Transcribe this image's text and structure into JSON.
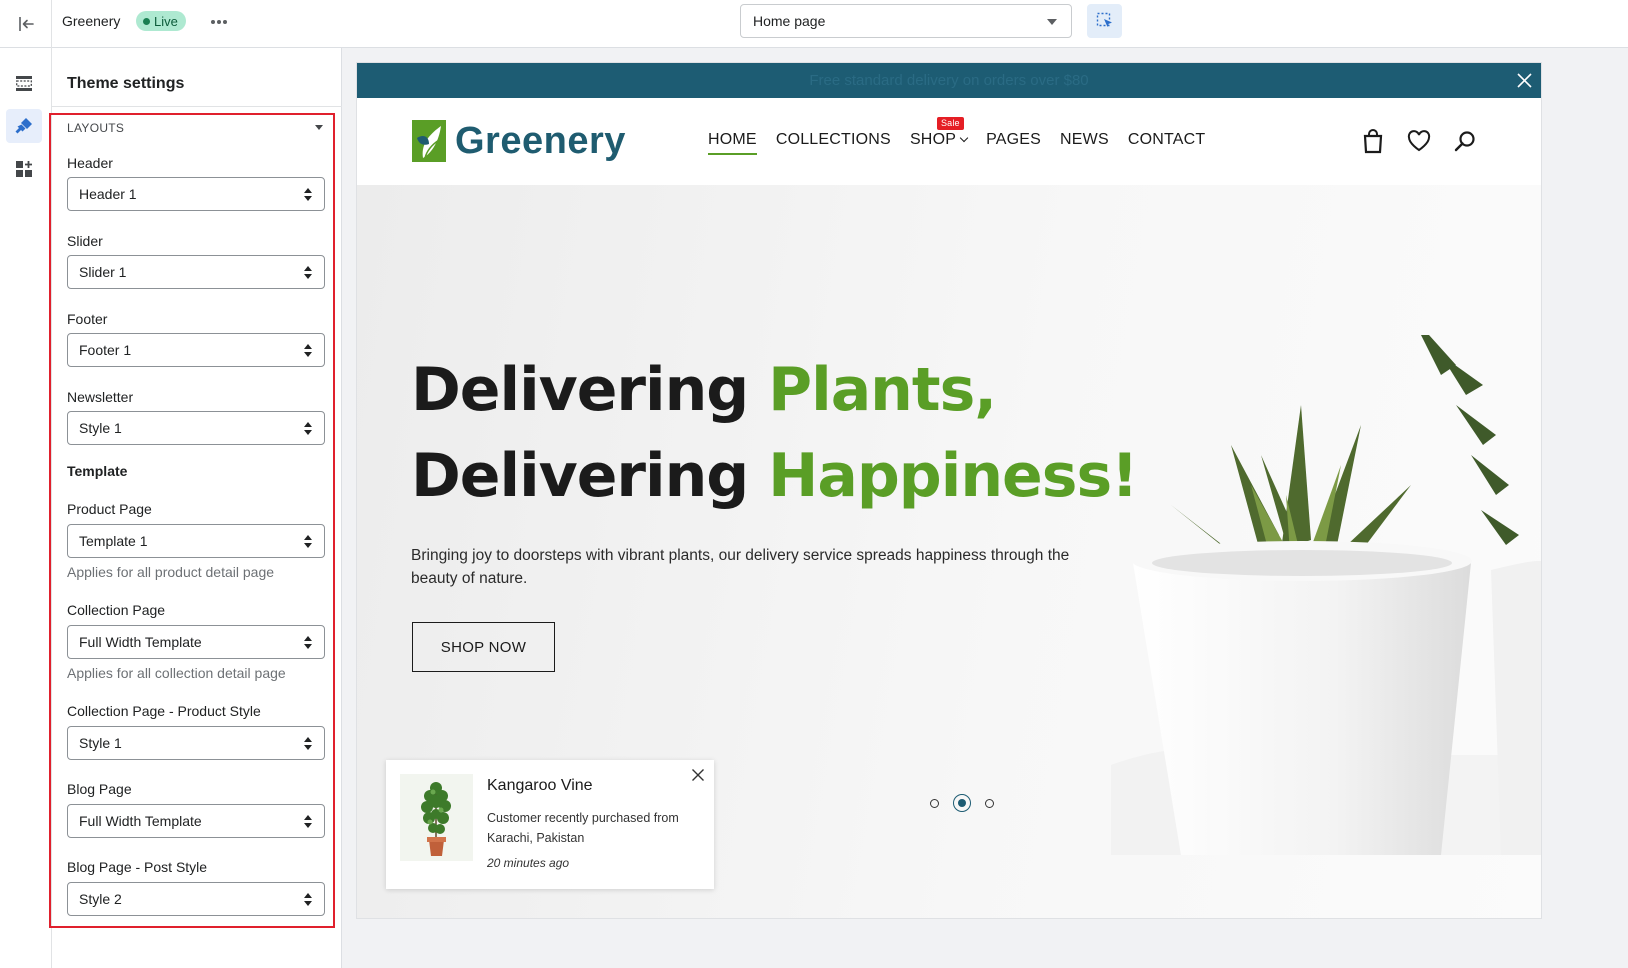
{
  "topbar": {
    "store_name": "Greenery",
    "live_badge": "Live",
    "page_select": "Home page"
  },
  "panel": {
    "title": "Theme settings",
    "section_label": "LAYOUTS",
    "fields": {
      "header": {
        "label": "Header",
        "value": "Header 1"
      },
      "slider": {
        "label": "Slider",
        "value": "Slider 1"
      },
      "footer": {
        "label": "Footer",
        "value": "Footer 1"
      },
      "newsletter": {
        "label": "Newsletter",
        "value": "Style 1"
      },
      "product_page": {
        "label": "Product Page",
        "value": "Template 1",
        "help": "Applies for all product detail page"
      },
      "collection_page": {
        "label": "Collection Page",
        "value": "Full Width Template",
        "help": "Applies for all collection detail page"
      },
      "collection_product_style": {
        "label": "Collection Page - Product Style",
        "value": "Style 1"
      },
      "blog_page": {
        "label": "Blog Page",
        "value": "Full Width Template"
      },
      "blog_post_style": {
        "label": "Blog Page - Post Style",
        "value": "Style 2"
      }
    },
    "template_group_label": "Template"
  },
  "preview": {
    "announcement": "Free standard delivery on orders over $80",
    "logo_text": "Greenery",
    "nav": [
      {
        "label": "HOME"
      },
      {
        "label": "COLLECTIONS"
      },
      {
        "label": "SHOP",
        "badge": "Sale"
      },
      {
        "label": "PAGES"
      },
      {
        "label": "NEWS"
      },
      {
        "label": "CONTACT"
      }
    ],
    "hero": {
      "line1_dark": "Delivering ",
      "line1_green": "Plants,",
      "line2_dark": "Delivering ",
      "line2_green": "Happiness!",
      "description": "Bringing joy to doorsteps with vibrant plants, our delivery service spreads happiness through the beauty of nature.",
      "cta": "SHOP NOW"
    },
    "slider_active_index": 2,
    "popup": {
      "title": "Kangaroo Vine",
      "text": "Customer recently purchased  from Karachi, Pakistan",
      "time": "20 minutes ago"
    }
  },
  "colors": {
    "brand_green": "#5a9e26",
    "brand_teal": "#1d5c73",
    "highlight_red": "#e0202d",
    "sale_red": "#e51e25"
  }
}
